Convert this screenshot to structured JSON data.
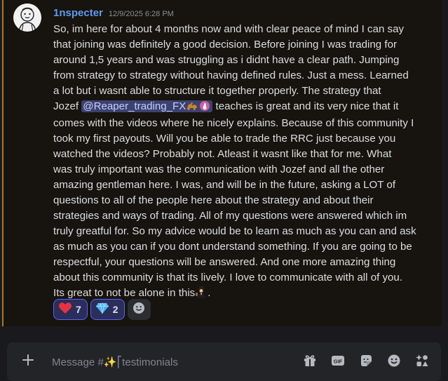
{
  "message": {
    "username": "1nspecter",
    "timestamp": "12/9/2025 6:28 PM",
    "mention": "@Reaper_trading_FX",
    "lines": {
      "l1": "So, im here for about 4 months now and with clear peace of mind I can say",
      "l2": "that joining was definitely a good decision. Before joining I was trading for",
      "l3": "around 1,5 years and was struggling as i didnt have a clear path. Jumping",
      "l4": "from strategy to strategy without having defined rules. Just a mess. Learned",
      "l5": "a lot but i wasnt able to structure it together properly. The strategy that",
      "l6a": "Jozef ",
      "l6b": " teaches is great and its very nice that it",
      "l7": "comes with the videos where he nicely explains. Because of this community I",
      "l8": "took my first payouts. Will you be able to trade the RRC just because you",
      "l9": "watched the videos? Probably not. Atleast it wasnt like that for me. What",
      "l10": "was truly important was the communication with Jozef and all the other",
      "l11": "amazing gentleman here. I was, and will be in the future, asking a LOT of",
      "l12": "questions to all of the people here about the strategy and about their",
      "l13": "strategies and ways of trading. All of my questions were answered which im",
      "l14": "truly greatful for. So my advice would be to learn as much as you can and ask",
      "l15": "as much as you can if you dont understand something. If you are going to be",
      "l16": "respectful, your questions will be answered. And one more amazing thing",
      "l17": "about this community is that its lively. I love to communicate with all of you.",
      "l18": "Its great to not be alone in this",
      "l18end": "."
    },
    "reactions": [
      {
        "emoji": "heart-emoji",
        "count": "7",
        "color": "#e8323f"
      },
      {
        "emoji": "gem-emoji",
        "count": "2",
        "color": "#49b3ea"
      }
    ]
  },
  "composer": {
    "placeholder": "Message #✨⎡testimonials"
  },
  "colors": {
    "username": "#5d9cf1",
    "highlight_border": "#a87b1d",
    "mention_bg": "#3c4270",
    "reaction_active_border": "#5865f2"
  },
  "icons": [
    "add-icon",
    "gift-icon",
    "gif-icon",
    "sticker-icon",
    "emoji-icon",
    "apps-icon"
  ]
}
